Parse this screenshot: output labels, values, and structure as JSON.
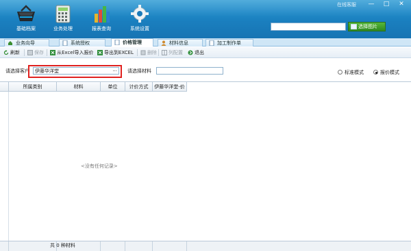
{
  "window": {
    "service_link": "在线客服",
    "controls": [
      "—",
      "□",
      "✕"
    ]
  },
  "toolbar_top": {
    "tools": [
      {
        "label": "基础档案",
        "icon": "basket-icon"
      },
      {
        "label": "业务处理",
        "icon": "calculator-icon"
      },
      {
        "label": "报表查询",
        "icon": "bar-chart-icon"
      },
      {
        "label": "系统设置",
        "icon": "gear-icon"
      }
    ],
    "picker_value": "",
    "picker_button": "选择图片"
  },
  "tabs": [
    {
      "label": "业务向导",
      "icon": "home-icon"
    },
    {
      "label": "系统授权",
      "icon": "document-icon"
    },
    {
      "label": "价格管理",
      "icon": "document-icon",
      "active": true
    },
    {
      "label": "材料信息",
      "icon": "person-icon"
    },
    {
      "label": "加工制作单",
      "icon": "document-icon"
    }
  ],
  "actions": [
    {
      "label": "刷新",
      "icon": "refresh-icon",
      "enabled": true
    },
    {
      "label": "保存",
      "icon": "save-icon",
      "enabled": false
    },
    {
      "label": "从Excel导入报价",
      "icon": "excel-import-icon",
      "enabled": true
    },
    {
      "label": "导出到EXCEL",
      "icon": "excel-export-icon",
      "enabled": true
    },
    {
      "label": "删除",
      "icon": "delete-icon",
      "enabled": false
    },
    {
      "label": "列配置",
      "icon": "columns-icon",
      "enabled": false
    },
    {
      "label": "退出",
      "icon": "exit-icon",
      "enabled": true
    }
  ],
  "filter": {
    "customer_label": "请选择客户",
    "customer_value": "伊藤华洋堂",
    "customer_dots": "···",
    "material_label": "请选择材料",
    "material_value": "",
    "modes": [
      {
        "label": "标准模式",
        "selected": false
      },
      {
        "label": "报价模式",
        "selected": true
      }
    ]
  },
  "grid": {
    "columns": [
      "所属类别",
      "材料",
      "单位",
      "计价方式",
      "伊藤华洋堂-价"
    ],
    "empty_text": "<没有任何记录>"
  },
  "footer": {
    "summary": "共 0 种材料"
  }
}
